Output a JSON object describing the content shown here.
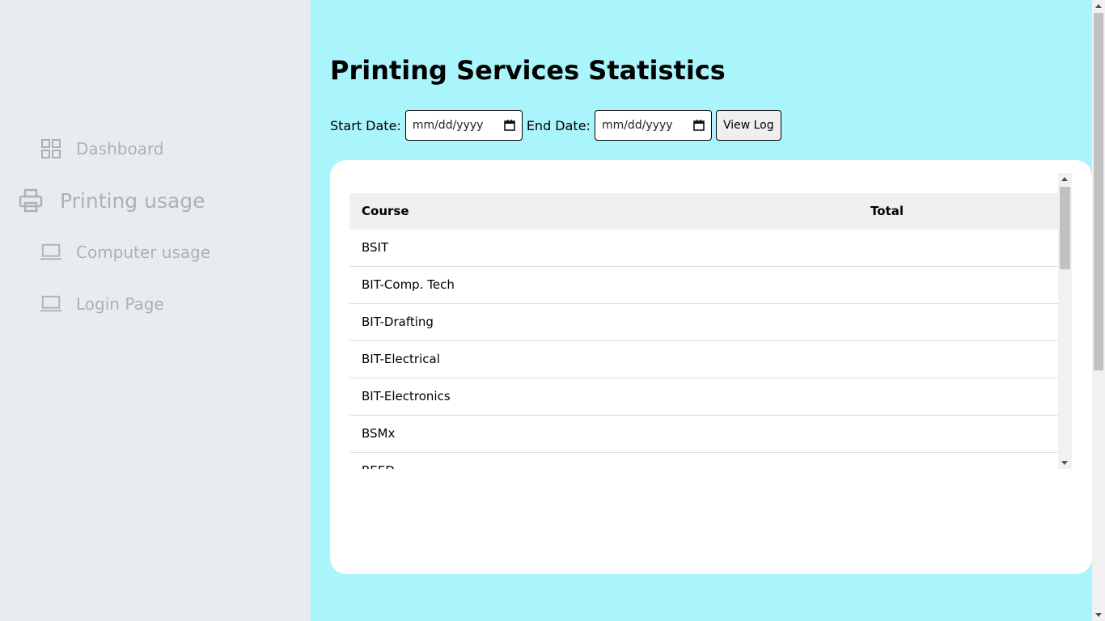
{
  "sidebar": {
    "items": [
      {
        "label": "Dashboard",
        "icon": "grid-icon"
      },
      {
        "label": "Printing usage",
        "icon": "printer-icon",
        "active": true
      },
      {
        "label": "Computer usage",
        "icon": "laptop-icon"
      },
      {
        "label": "Login Page",
        "icon": "laptop-icon"
      }
    ]
  },
  "main": {
    "title": "Printing Services Statistics",
    "filters": {
      "start_label": "Start Date:",
      "start_placeholder": "mm/dd/yyyy",
      "end_label": "End Date:",
      "end_placeholder": "mm/dd/yyyy",
      "view_button": "View Log"
    },
    "table": {
      "columns": [
        "Course",
        "Total"
      ],
      "rows": [
        {
          "course": "BSIT",
          "total": ""
        },
        {
          "course": "BIT-Comp. Tech",
          "total": ""
        },
        {
          "course": "BIT-Drafting",
          "total": ""
        },
        {
          "course": "BIT-Electrical",
          "total": ""
        },
        {
          "course": "BIT-Electronics",
          "total": ""
        },
        {
          "course": "BSMx",
          "total": ""
        },
        {
          "course": "BEED",
          "total": ""
        }
      ]
    }
  },
  "colors": {
    "main_background": "#aaf4fb",
    "sidebar_background": "#e8ecf0",
    "sidebar_text": "#b0b0b0",
    "card_background": "#ffffff",
    "table_header_background": "#f0f0f0"
  }
}
